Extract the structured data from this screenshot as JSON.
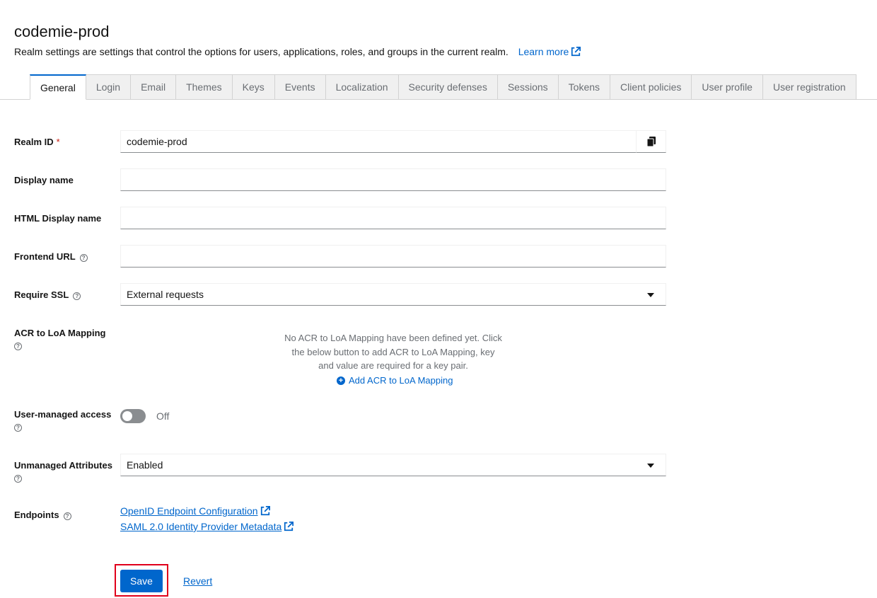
{
  "header": {
    "title": "codemie-prod",
    "description": "Realm settings are settings that control the options for users, applications, roles, and groups in the current realm.",
    "learn_more": "Learn more"
  },
  "tabs": [
    {
      "label": "General",
      "active": true
    },
    {
      "label": "Login"
    },
    {
      "label": "Email"
    },
    {
      "label": "Themes"
    },
    {
      "label": "Keys"
    },
    {
      "label": "Events"
    },
    {
      "label": "Localization"
    },
    {
      "label": "Security defenses"
    },
    {
      "label": "Sessions"
    },
    {
      "label": "Tokens"
    },
    {
      "label": "Client policies"
    },
    {
      "label": "User profile"
    },
    {
      "label": "User registration"
    }
  ],
  "form": {
    "realm_id": {
      "label": "Realm ID",
      "required_mark": "*",
      "value": "codemie-prod"
    },
    "display_name": {
      "label": "Display name",
      "value": ""
    },
    "html_display_name": {
      "label": "HTML Display name",
      "value": ""
    },
    "frontend_url": {
      "label": "Frontend URL",
      "value": ""
    },
    "require_ssl": {
      "label": "Require SSL",
      "value": "External requests"
    },
    "acr_loa": {
      "label": "ACR to LoA Mapping",
      "empty_text": "No ACR to LoA Mapping have been defined yet. Click the below button to add ACR to LoA Mapping, key and value are required for a key pair.",
      "add_label": "Add ACR to LoA Mapping"
    },
    "user_managed_access": {
      "label": "User-managed access",
      "state_text": "Off",
      "on": false
    },
    "unmanaged_attributes": {
      "label": "Unmanaged Attributes",
      "value": "Enabled"
    },
    "endpoints": {
      "label": "Endpoints",
      "links": [
        "OpenID Endpoint Configuration",
        "SAML 2.0 Identity Provider Metadata"
      ]
    }
  },
  "actions": {
    "save": "Save",
    "revert": "Revert"
  },
  "colors": {
    "accent": "#0066cc",
    "required": "#c9190b",
    "highlight": "#e0001b"
  }
}
